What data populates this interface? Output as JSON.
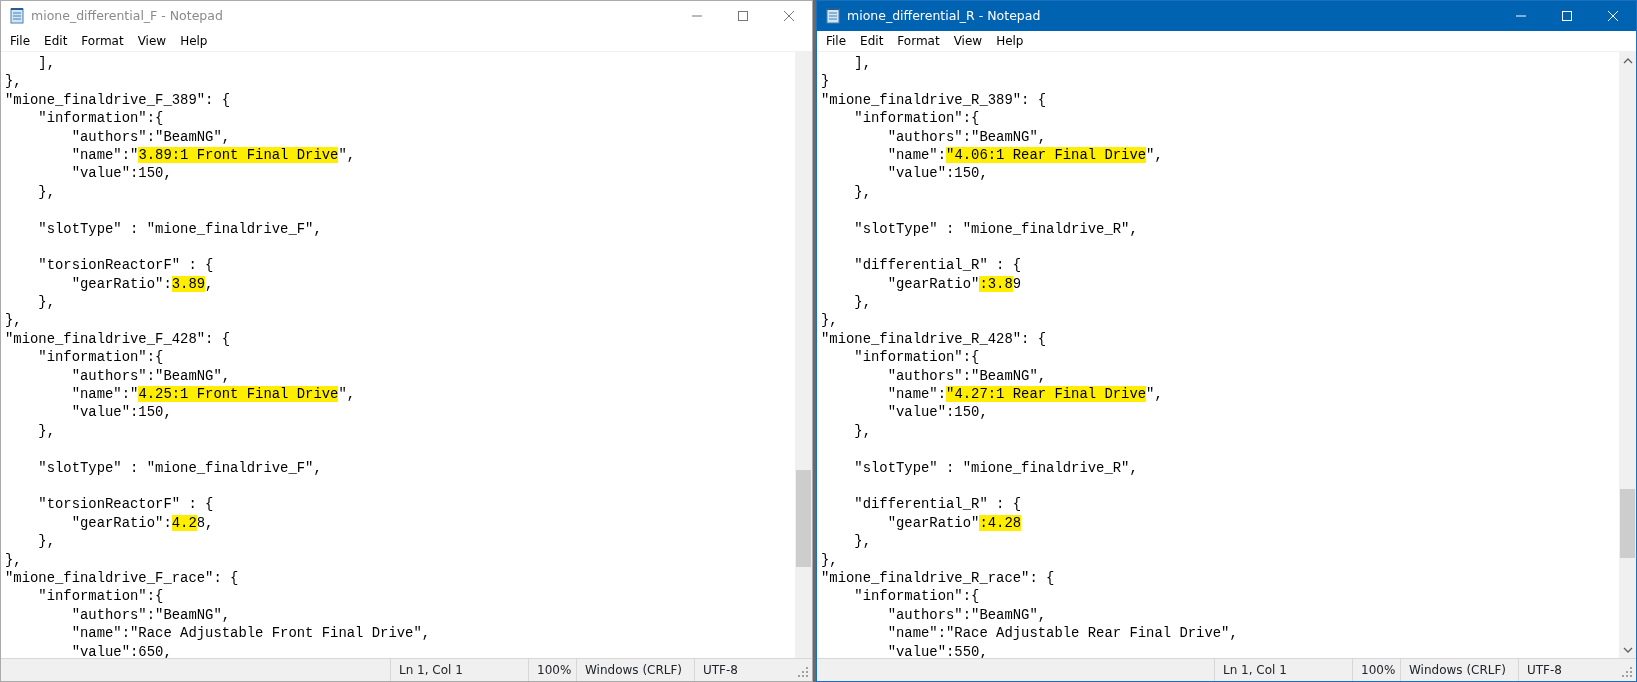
{
  "windows": [
    {
      "title": "mione_differential_F - Notepad",
      "active": false,
      "menu": [
        "File",
        "Edit",
        "Format",
        "View",
        "Help"
      ],
      "lines": [
        "    ],",
        "},",
        "\"mione_finaldrive_F_389\": {",
        "    \"information\":{",
        "        \"authors\":\"BeamNG\",",
        {
          "parts": [
            {
              "text": "        \"name\":\"",
              "highlighted": false
            },
            {
              "text": "3.89:1 Front Final Drive",
              "highlighted": true
            },
            {
              "text": "\",",
              "highlighted": false
            }
          ]
        },
        "        \"value\":150,",
        "    },",
        {
          "kind": "blank"
        },
        "    \"slotType\" : \"mione_finaldrive_F\",",
        {
          "kind": "blank"
        },
        "    \"torsionReactorF\" : {",
        {
          "parts": [
            {
              "text": "        \"gearRatio\":",
              "highlighted": false
            },
            {
              "text": "3.89",
              "highlighted": true
            },
            {
              "text": ",",
              "highlighted": false
            }
          ]
        },
        "    },",
        "},",
        "\"mione_finaldrive_F_428\": {",
        "    \"information\":{",
        "        \"authors\":\"BeamNG\",",
        {
          "parts": [
            {
              "text": "        \"name\":\"",
              "highlighted": false
            },
            {
              "text": "4.25:1 Front Final Drive",
              "highlighted": true
            },
            {
              "text": "\",",
              "highlighted": false
            }
          ]
        },
        "        \"value\":150,",
        "    },",
        {
          "kind": "blank"
        },
        "    \"slotType\" : \"mione_finaldrive_F\",",
        {
          "kind": "blank"
        },
        "    \"torsionReactorF\" : {",
        {
          "parts": [
            {
              "text": "        \"gearRatio\":",
              "highlighted": false
            },
            {
              "text": "4.2",
              "highlighted": true
            },
            {
              "text": "8,",
              "highlighted": false
            }
          ]
        },
        "    },",
        "},",
        "\"mione_finaldrive_F_race\": {",
        "    \"information\":{",
        "        \"authors\":\"BeamNG\",",
        "        \"name\":\"Race Adjustable Front Final Drive\",",
        "        \"value\":650,"
      ],
      "status": {
        "position": "Ln 1, Col 1",
        "zoom": "100%",
        "line_endings": "Windows (CRLF)",
        "encoding": "UTF-8"
      }
    },
    {
      "title": "mione_differential_R - Notepad",
      "active": true,
      "menu": [
        "File",
        "Edit",
        "Format",
        "View",
        "Help"
      ],
      "lines": [
        "    ],",
        "}",
        "\"mione_finaldrive_R_389\": {",
        "    \"information\":{",
        "        \"authors\":\"BeamNG\",",
        {
          "parts": [
            {
              "text": "        \"name\":",
              "highlighted": false
            },
            {
              "text": "\"4.06:1 Rear Final Drive",
              "highlighted": true
            },
            {
              "text": "\",",
              "highlighted": false
            }
          ]
        },
        "        \"value\":150,",
        "    },",
        {
          "kind": "blank"
        },
        "    \"slotType\" : \"mione_finaldrive_R\",",
        {
          "kind": "blank"
        },
        "    \"differential_R\" : {",
        {
          "parts": [
            {
              "text": "        \"gearRatio\"",
              "highlighted": false
            },
            {
              "text": ":3.8",
              "highlighted": true
            },
            {
              "text": "9",
              "highlighted": false
            }
          ]
        },
        "    },",
        "},",
        "\"mione_finaldrive_R_428\": {",
        "    \"information\":{",
        "        \"authors\":\"BeamNG\",",
        {
          "parts": [
            {
              "text": "        \"name\":",
              "highlighted": false
            },
            {
              "text": "\"4.27:1 Rear Final Drive",
              "highlighted": true
            },
            {
              "text": "\",",
              "highlighted": false
            }
          ]
        },
        "        \"value\":150,",
        "    },",
        {
          "kind": "blank"
        },
        "    \"slotType\" : \"mione_finaldrive_R\",",
        {
          "kind": "blank"
        },
        "    \"differential_R\" : {",
        {
          "parts": [
            {
              "text": "        \"gearRatio\"",
              "highlighted": false
            },
            {
              "text": ":4.28",
              "highlighted": true
            }
          ]
        },
        "    },",
        "},",
        "\"mione_finaldrive_R_race\": {",
        "    \"information\":{",
        "        \"authors\":\"BeamNG\",",
        "        \"name\":\"Race Adjustable Rear Final Drive\",",
        "        \"value\":550,"
      ],
      "status": {
        "position": "Ln 1, Col 1",
        "zoom": "100%",
        "line_endings": "Windows (CRLF)",
        "encoding": "UTF-8"
      }
    }
  ]
}
